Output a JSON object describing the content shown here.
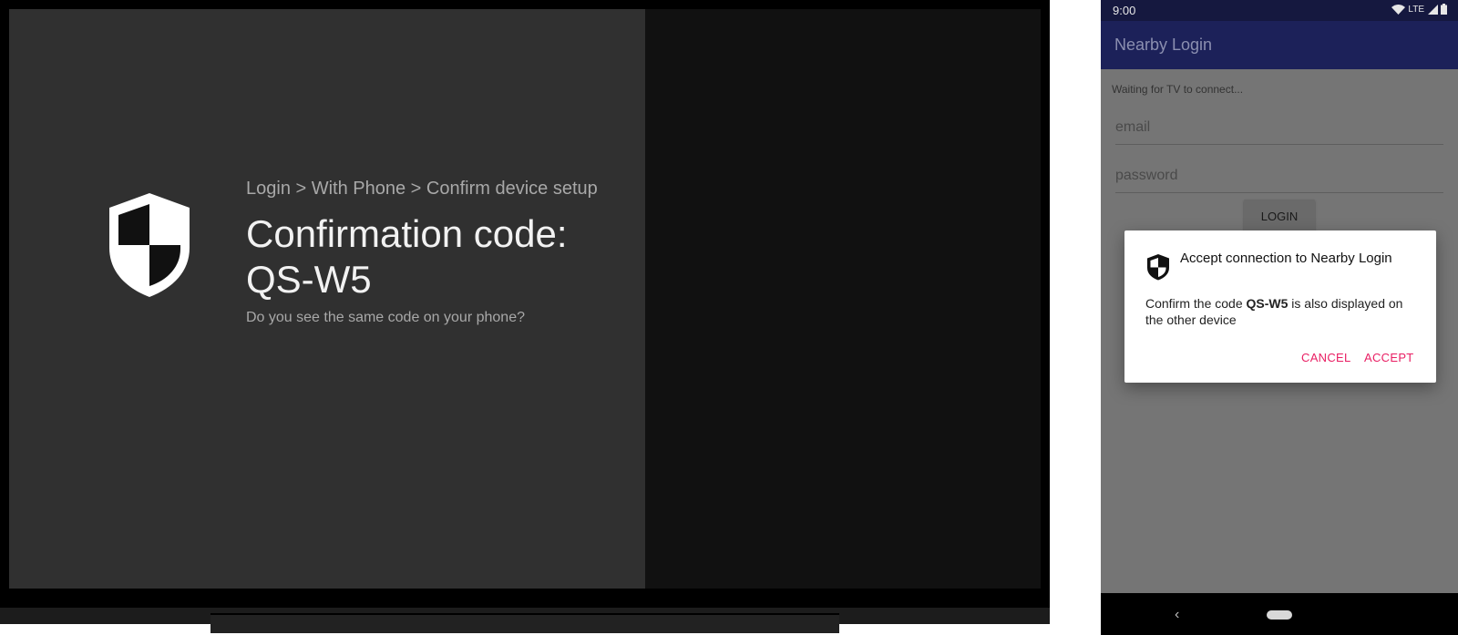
{
  "tv": {
    "breadcrumb": "Login > With Phone > Confirm device setup",
    "title": "Confirmation code: QS-W5",
    "question": "Do you see the same code on your phone?",
    "icon": "shield-icon"
  },
  "phone": {
    "status_bar": {
      "time": "9:00",
      "network": "LTE"
    },
    "app_bar": {
      "title": "Nearby Login"
    },
    "waiting_text": "Waiting for TV to connect...",
    "email_placeholder": "email",
    "password_placeholder": "password",
    "login_label": "LOGIN",
    "dialog": {
      "title": "Accept connection to Nearby Login",
      "body_prefix": "Confirm the code ",
      "code": "QS-W5",
      "body_suffix": " is also displayed on the other device",
      "cancel_label": "CANCEL",
      "accept_label": "ACCEPT",
      "icon": "shield-icon"
    }
  },
  "colors": {
    "accent": "#e91e63",
    "app_bar": "#1c2159",
    "tv_pane": "#303030"
  }
}
